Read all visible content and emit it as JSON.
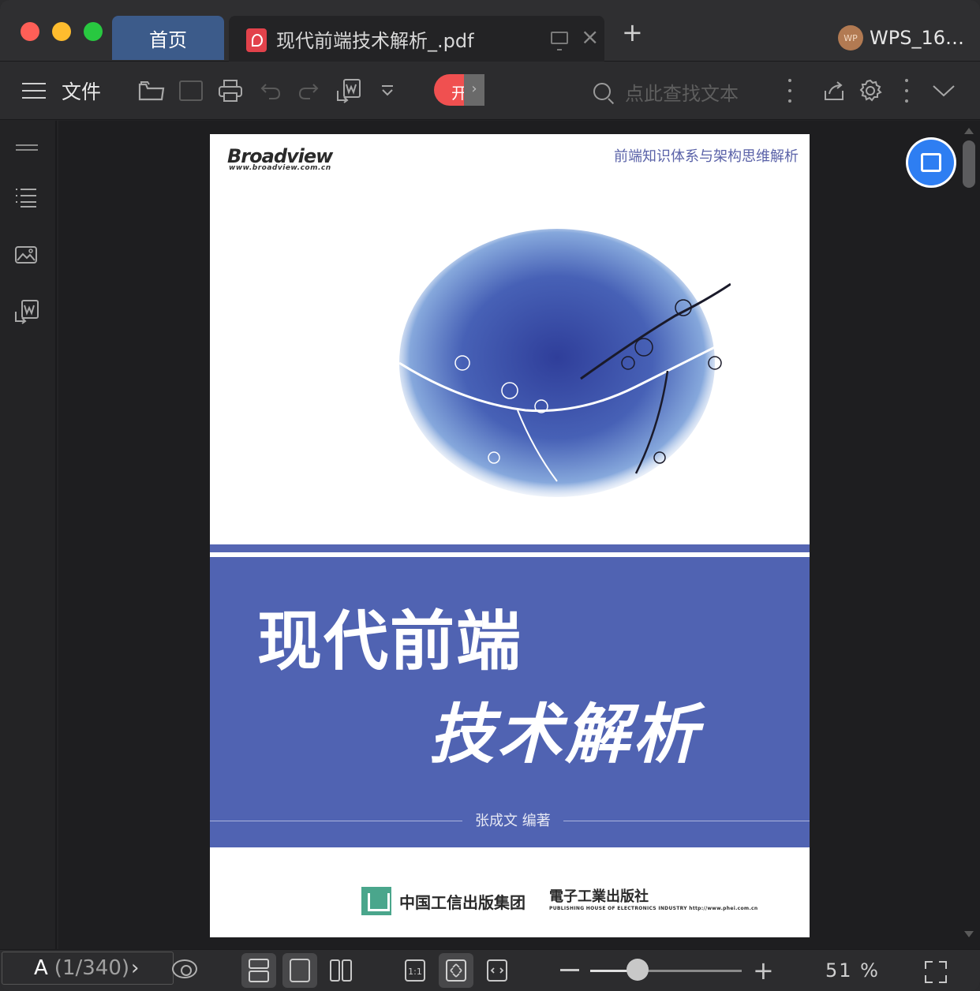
{
  "tabs": {
    "home_label": "首页",
    "doc_title": "现代前端技术解析_.pdf",
    "add_label": "+",
    "close_label": "×"
  },
  "user": {
    "avatar_text": "WP",
    "name": "WPS_16…"
  },
  "toolbar": {
    "menu_label": "文件",
    "pill_char": "开",
    "pill_arrow": "›",
    "search_placeholder": "点此查找文本"
  },
  "document": {
    "publisher_logo": "Broadview",
    "publisher_url": "www.broadview.com.cn",
    "subtitle": "前端知识体系与架构思维解析",
    "title_line1": "现代前端",
    "title_line2": "技术解析",
    "author": "张成文 编著",
    "publisher_group": "中国工信出版集团",
    "publisher_house": "電子工業出版社",
    "publisher_house_en": "PUBLISHING HOUSE OF ELECTRONICS INDUSTRY http://www.phei.com.cn"
  },
  "status": {
    "page_prefix": "A",
    "page_indicator": "(1/340)",
    "page_next": "›",
    "zoom_percent": "51 %",
    "zoom_level": 0.31,
    "zoom_minus": "−",
    "zoom_plus": "+"
  },
  "colors": {
    "accent_blue": "#2e7ef2",
    "cover_band": "#5063b2",
    "active_tab": "#3c5b8a"
  }
}
